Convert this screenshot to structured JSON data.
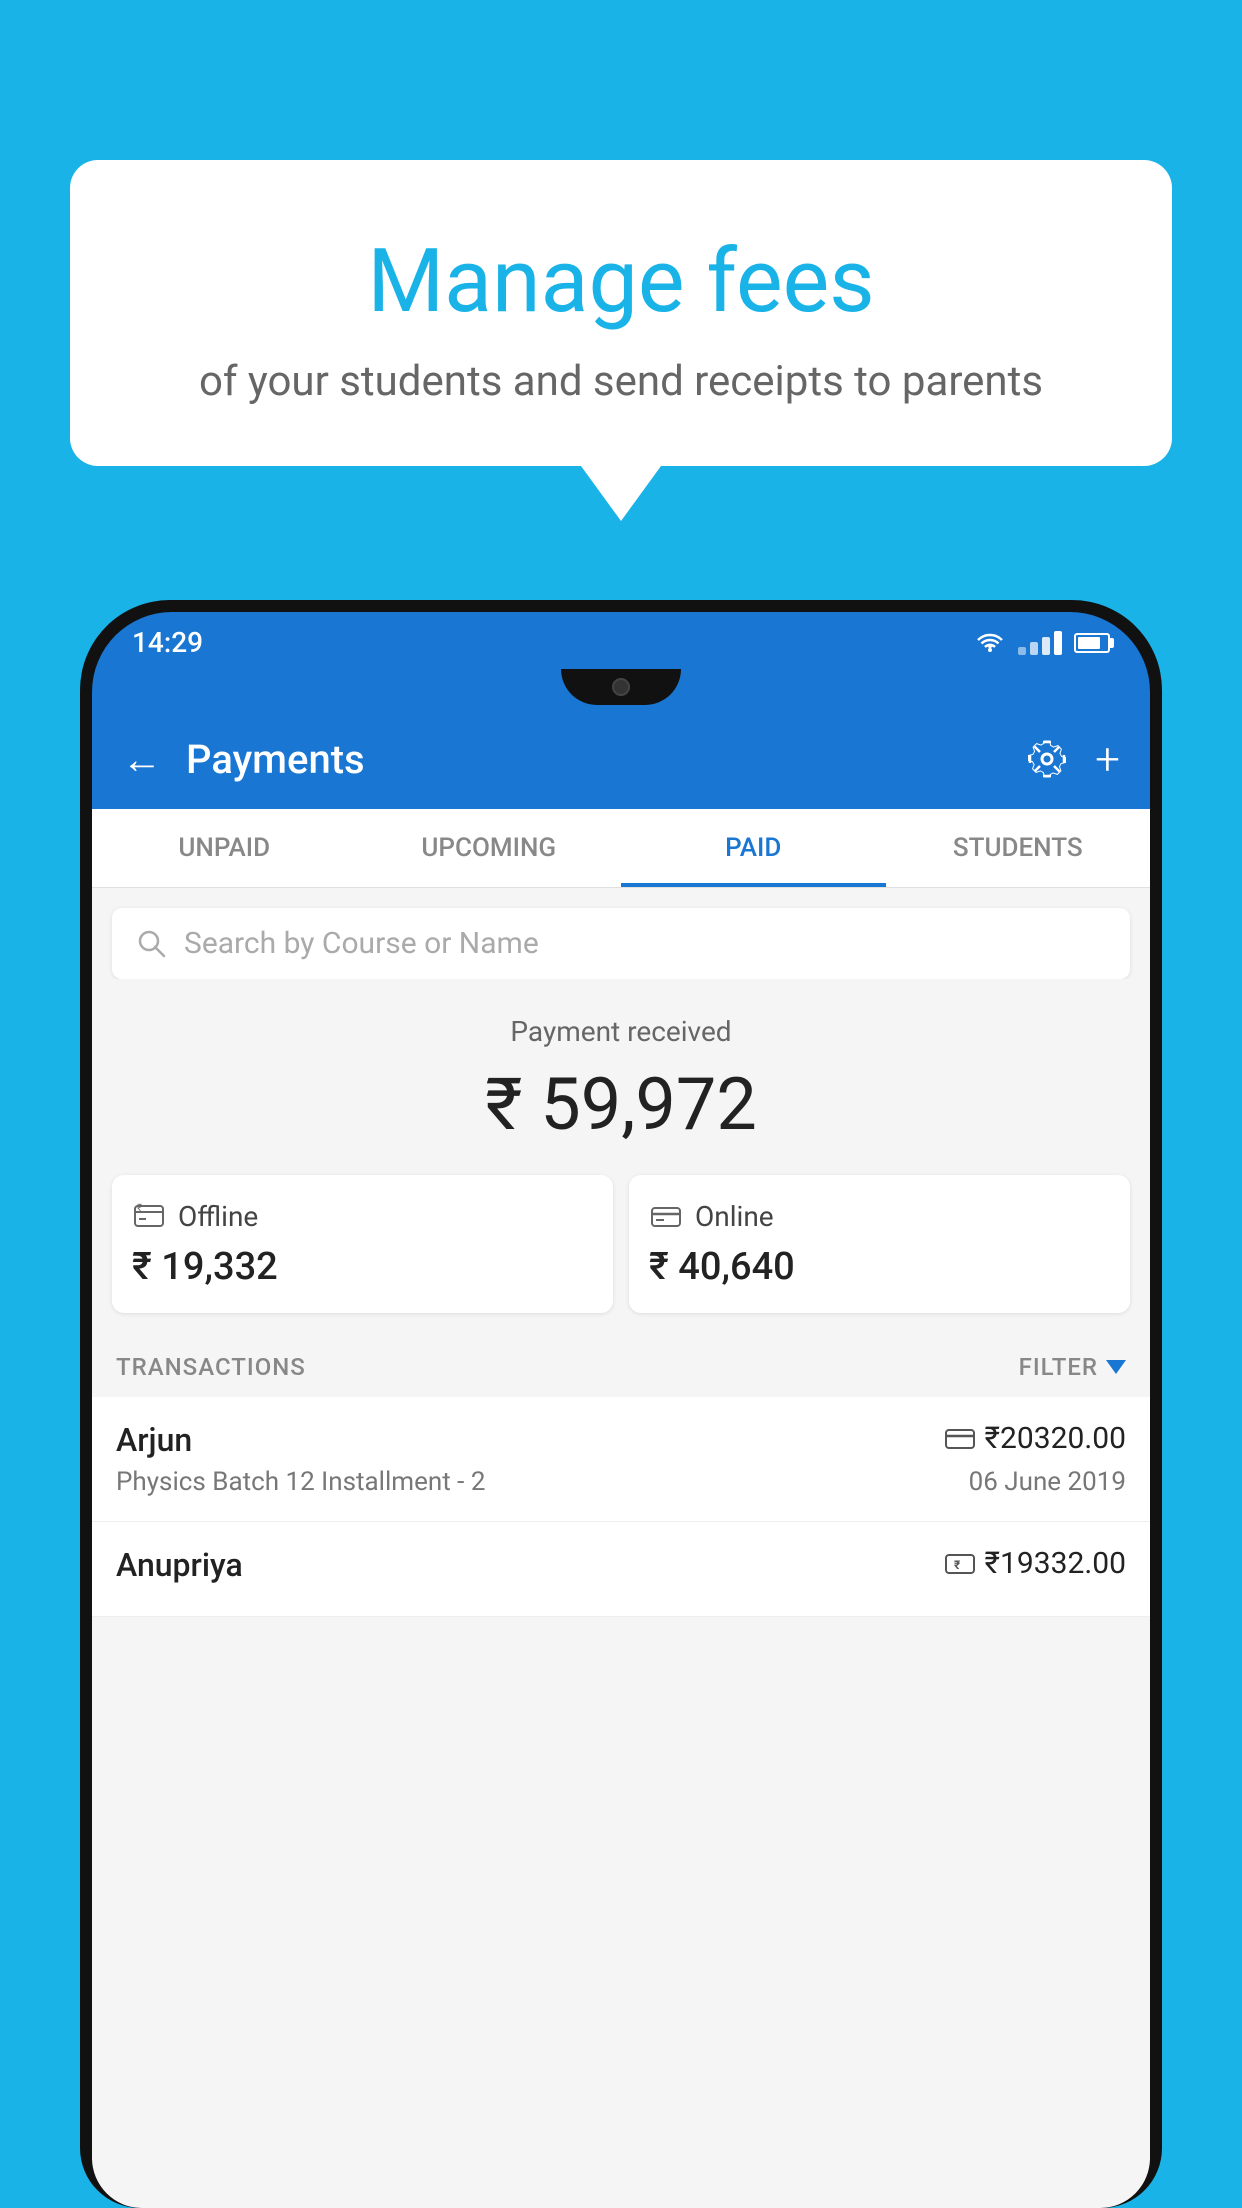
{
  "background_color": "#1ab3e8",
  "speech_bubble": {
    "title": "Manage fees",
    "subtitle": "of your students and send receipts to parents"
  },
  "status_bar": {
    "time": "14:29",
    "wifi": true,
    "signal": true,
    "battery": true
  },
  "app_header": {
    "title": "Payments",
    "back_label": "←",
    "plus_label": "+"
  },
  "tabs": [
    {
      "label": "UNPAID",
      "active": false
    },
    {
      "label": "UPCOMING",
      "active": false
    },
    {
      "label": "PAID",
      "active": true
    },
    {
      "label": "STUDENTS",
      "active": false
    }
  ],
  "search": {
    "placeholder": "Search by Course or Name"
  },
  "payment_received": {
    "label": "Payment received",
    "amount": "₹ 59,972"
  },
  "payment_cards": [
    {
      "type": "offline",
      "label": "Offline",
      "amount": "₹ 19,332"
    },
    {
      "type": "online",
      "label": "Online",
      "amount": "₹ 40,640"
    }
  ],
  "transactions": {
    "header_label": "TRANSACTIONS",
    "filter_label": "FILTER",
    "items": [
      {
        "name": "Arjun",
        "course": "Physics Batch 12 Installment - 2",
        "amount": "₹20320.00",
        "date": "06 June 2019",
        "payment_type": "online"
      },
      {
        "name": "Anupriya",
        "course": "",
        "amount": "₹19332.00",
        "date": "",
        "payment_type": "offline"
      }
    ]
  }
}
